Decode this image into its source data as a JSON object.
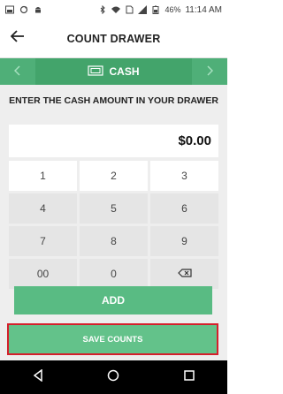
{
  "status_bar": {
    "battery": "46%",
    "time": "11:14 AM"
  },
  "header": {
    "title": "COUNT DRAWER"
  },
  "tab": {
    "label": "CASH"
  },
  "main": {
    "instruction": "ENTER THE CASH AMOUNT IN YOUR DRAWER",
    "amount": "$0.00"
  },
  "keypad": {
    "keys": [
      "1",
      "2",
      "3",
      "4",
      "5",
      "6",
      "7",
      "8",
      "9",
      "00",
      "0"
    ]
  },
  "actions": {
    "add_label": "ADD",
    "save_label": "SAVE COUNTS"
  },
  "colors": {
    "green": "#5bbf86",
    "dark_green": "#43a46b",
    "highlight": "#d51f2b"
  }
}
